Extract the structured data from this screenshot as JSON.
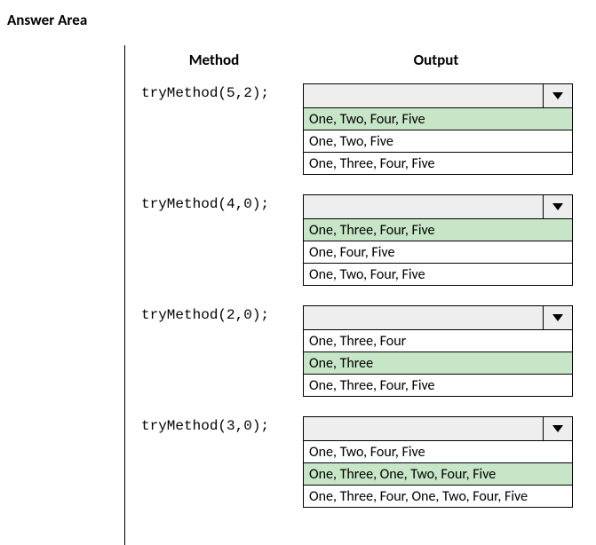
{
  "title": "Answer Area",
  "headers": {
    "method": "Method",
    "output": "Output"
  },
  "rows": [
    {
      "method": "tryMethod(5,2);",
      "options": [
        {
          "text": "One, Two, Four, Five",
          "highlighted": true
        },
        {
          "text": "One, Two, Five",
          "highlighted": false
        },
        {
          "text": "One, Three, Four, Five",
          "highlighted": false
        }
      ]
    },
    {
      "method": "tryMethod(4,0);",
      "options": [
        {
          "text": "One, Three, Four, Five",
          "highlighted": true
        },
        {
          "text": "One, Four, Five",
          "highlighted": false
        },
        {
          "text": "One, Two, Four, Five",
          "highlighted": false
        }
      ]
    },
    {
      "method": "tryMethod(2,0);",
      "options": [
        {
          "text": "One, Three, Four",
          "highlighted": false
        },
        {
          "text": "One, Three",
          "highlighted": true
        },
        {
          "text": "One, Three, Four, Five",
          "highlighted": false
        }
      ]
    },
    {
      "method": "tryMethod(3,0);",
      "options": [
        {
          "text": "One, Two, Four, Five",
          "highlighted": false
        },
        {
          "text": "One, Three, One, Two, Four, Five",
          "highlighted": true
        },
        {
          "text": "One, Three, Four, One, Two, Four, Five",
          "highlighted": false
        }
      ]
    }
  ]
}
